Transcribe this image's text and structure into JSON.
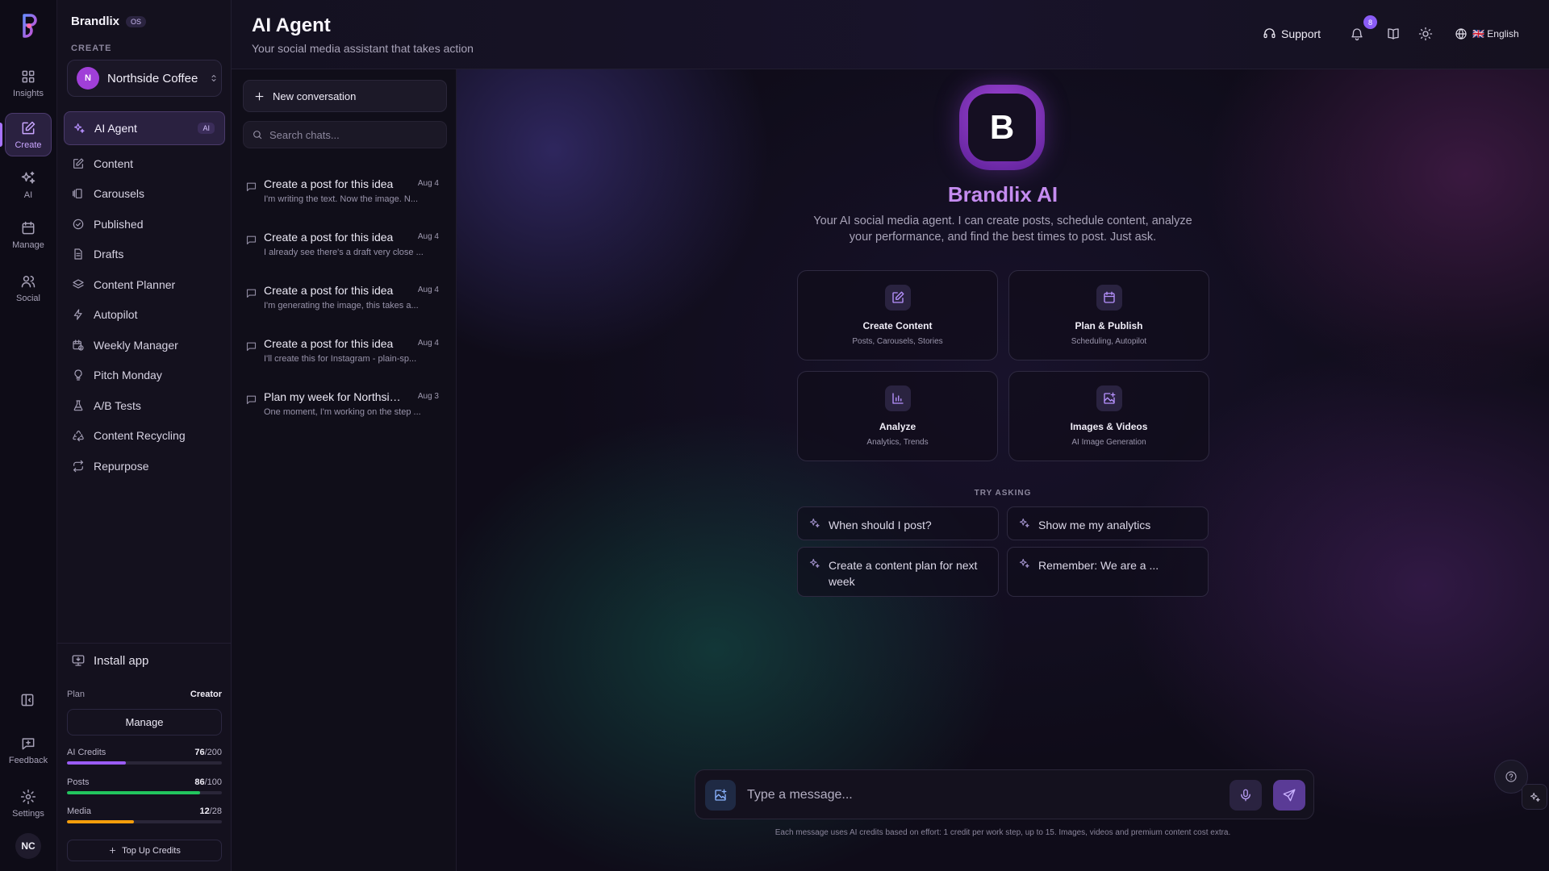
{
  "rail": {
    "items": [
      {
        "label": "Insights",
        "icon": "grid-icon"
      },
      {
        "label": "Create",
        "icon": "edit-icon"
      },
      {
        "label": "AI",
        "icon": "sparkles-icon"
      },
      {
        "label": "Manage",
        "icon": "calendar-icon"
      },
      {
        "label": "Social",
        "icon": "users-icon"
      }
    ],
    "feedback_label": "Feedback",
    "settings_label": "Settings",
    "user_initials": "NC"
  },
  "sidebar": {
    "brand": "Brandlix",
    "os_badge": "OS",
    "section": "CREATE",
    "workspace": {
      "initial": "N",
      "name": "Northside Coffee"
    },
    "items": [
      {
        "label": "AI Agent",
        "badge": "AI",
        "icon": "sparkles-icon"
      },
      {
        "label": "Content",
        "icon": "edit-icon"
      },
      {
        "label": "Carousels",
        "icon": "layers-icon"
      },
      {
        "label": "Published",
        "icon": "check-circle-icon"
      },
      {
        "label": "Drafts",
        "icon": "file-icon"
      },
      {
        "label": "Content Planner",
        "icon": "stack-icon"
      },
      {
        "label": "Autopilot",
        "icon": "bolt-icon"
      },
      {
        "label": "Weekly Manager",
        "icon": "calendar-clock-icon"
      },
      {
        "label": "Pitch Monday",
        "icon": "bulb-icon"
      },
      {
        "label": "A/B Tests",
        "icon": "flask-icon"
      },
      {
        "label": "Content Recycling",
        "icon": "recycle-icon"
      },
      {
        "label": "Repurpose",
        "icon": "repeat-icon"
      }
    ],
    "install_label": "Install app",
    "plan_label": "Plan",
    "plan_value": "Creator",
    "manage_label": "Manage",
    "meters": [
      {
        "label": "AI Credits",
        "used": "76",
        "total": "/200",
        "fraction": 0.38,
        "color": "#9b5cf6"
      },
      {
        "label": "Posts",
        "used": "86",
        "total": "/100",
        "fraction": 0.86,
        "color": "#22c55e"
      },
      {
        "label": "Media",
        "used": "12",
        "total": "/28",
        "fraction": 0.43,
        "color": "#f59e0b"
      }
    ],
    "topup_label": "Top Up Credits"
  },
  "header": {
    "title": "AI Agent",
    "subtitle": "Your social media assistant that takes action",
    "support_label": "Support",
    "notification_count": "8",
    "language": "🇬🇧 English"
  },
  "chatlist": {
    "new_label": "New conversation",
    "search_placeholder": "Search chats...",
    "conversations": [
      {
        "title": "Create a post for this idea",
        "date": "Aug 4",
        "snippet": "I'm writing the text. Now the image. N..."
      },
      {
        "title": "Create a post for this idea",
        "date": "Aug 4",
        "snippet": "I already see there's a draft very close ..."
      },
      {
        "title": "Create a post for this idea",
        "date": "Aug 4",
        "snippet": "I'm generating the image, this takes a..."
      },
      {
        "title": "Create a post for this idea",
        "date": "Aug 4",
        "snippet": "I'll create this for Instagram - plain-sp..."
      },
      {
        "title": "Plan my week for Northside Coffee",
        "date": "Aug 3",
        "snippet": "One moment, I'm working on the step ..."
      }
    ]
  },
  "main": {
    "logo_letter": "B",
    "title": "Brandlix AI",
    "description": "Your AI social media agent. I can create posts, schedule content, analyze your performance, and find the best times to post. Just ask.",
    "cards": [
      {
        "title": "Create Content",
        "sub": "Posts, Carousels, Stories",
        "icon": "edit-icon"
      },
      {
        "title": "Plan & Publish",
        "sub": "Scheduling, Autopilot",
        "icon": "calendar-icon"
      },
      {
        "title": "Analyze",
        "sub": "Analytics, Trends",
        "icon": "bar-chart-icon"
      },
      {
        "title": "Images & Videos",
        "sub": "AI Image Generation",
        "icon": "image-plus-icon"
      }
    ],
    "try_label": "TRY ASKING",
    "suggestions": [
      "When should I post?",
      "Show me my analytics",
      "Create a content plan for next week",
      "Remember: We are a ..."
    ],
    "composer_placeholder": "Type a message...",
    "footnote": "Each message uses AI credits based on effort: 1 credit per work step, up to 15. Images, videos and premium content cost extra."
  }
}
